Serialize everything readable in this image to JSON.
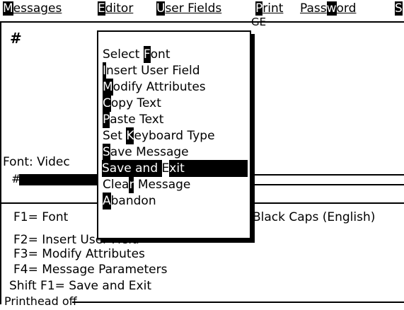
{
  "menubar": {
    "items": [
      {
        "hot": "M",
        "rest": "essages"
      },
      {
        "hot": "E",
        "rest": "ditor"
      },
      {
        "hot": "U",
        "rest": "ser Fields"
      },
      {
        "hot": "P",
        "rest": "rint"
      },
      {
        "pre": "Pass",
        "hot": "w",
        "rest": "ord"
      },
      {
        "hot": "S",
        "rest": ""
      }
    ]
  },
  "editor": {
    "title_fragment": "GE",
    "content_char": "#",
    "font_label": "Font: Videc",
    "font_hash": "#"
  },
  "dropdown": {
    "items": [
      {
        "pre": "Select ",
        "hot": "F",
        "rest": "ont"
      },
      {
        "pre": "",
        "hot": "I",
        "rest": "nsert User Field"
      },
      {
        "pre": "",
        "hot": "M",
        "rest": "odify Attributes"
      },
      {
        "pre": "",
        "hot": "C",
        "rest": "opy Text"
      },
      {
        "pre": "",
        "hot": "P",
        "rest": "aste Text"
      },
      {
        "pre": "Set ",
        "hot": "K",
        "rest": "eyboard Type"
      },
      {
        "pre": "",
        "hot": "S",
        "rest": "ave Message"
      },
      {
        "pre": "Save and ",
        "hot": "E",
        "rest": "xit"
      },
      {
        "pre": "Clea",
        "hot": "r",
        "rest": " Message"
      },
      {
        "pre": "",
        "hot": "A",
        "rest": "bandon"
      }
    ],
    "selected_index": 7
  },
  "function_keys": {
    "f1": "F1= Font",
    "f1_right": "Black Caps (English)",
    "f2": "F2= Insert User Field",
    "f3": "F3= Modify Attributes",
    "f4": "F4= Message Parameters",
    "shift_f1": "Shift F1= Save and Exit"
  },
  "status": {
    "text": "Printhead off"
  }
}
